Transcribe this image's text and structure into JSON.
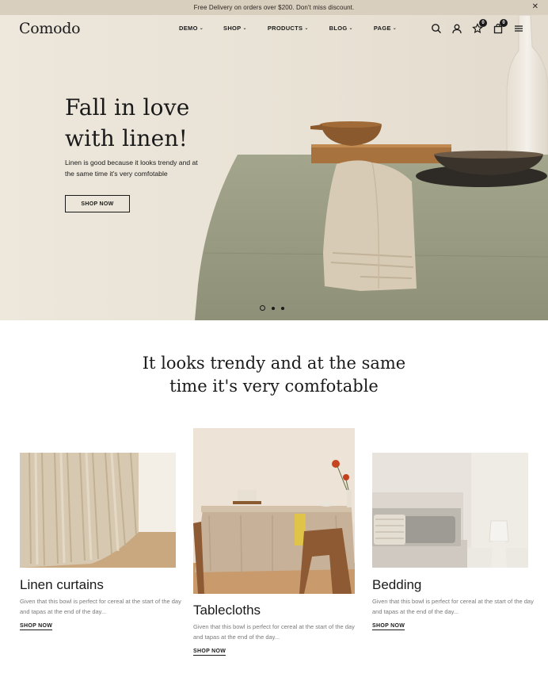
{
  "announcement": {
    "text": "Free Delivery on orders over $200. Don't miss discount.",
    "close_icon": "close-icon"
  },
  "header": {
    "logo": "Comodo",
    "nav": [
      {
        "label": "DEMO"
      },
      {
        "label": "SHOP"
      },
      {
        "label": "PRODUCTS"
      },
      {
        "label": "BLOG"
      },
      {
        "label": "PAGE"
      }
    ],
    "wishlist_count": "0",
    "cart_count": "0",
    "icons": [
      "search-icon",
      "user-icon",
      "wishlist-icon",
      "cart-icon",
      "menu-icon"
    ]
  },
  "hero": {
    "title_line1": "Fall in love",
    "title_line2": "with linen!",
    "subtitle": "Linen is good because it looks trendy and at the same time it's very comfotable",
    "button": "SHOP NOW",
    "slides": 3,
    "active_slide": 1
  },
  "section": {
    "title_line1": "It looks trendy and at the same",
    "title_line2": "time it's very comfotable"
  },
  "cards": [
    {
      "title": "Linen curtains",
      "description": "Given that this bowl is perfect for cereal at the start of the day and tapas at the end of the day...",
      "link": "SHOP NOW"
    },
    {
      "title": "Tablecloths",
      "description": "Given that this bowl is perfect for cereal at the start of the day and tapas at the end of the day...",
      "link": "SHOP NOW"
    },
    {
      "title": "Bedding",
      "description": "Given that this bowl is perfect for cereal at the start of the day and tapas at the end of the day...",
      "link": "SHOP NOW"
    }
  ],
  "colors": {
    "announcement_bg": "#d9cfbf",
    "hero_bg": "#ebe4d8",
    "text": "#1a1a1a",
    "muted": "#7a7a7a"
  }
}
